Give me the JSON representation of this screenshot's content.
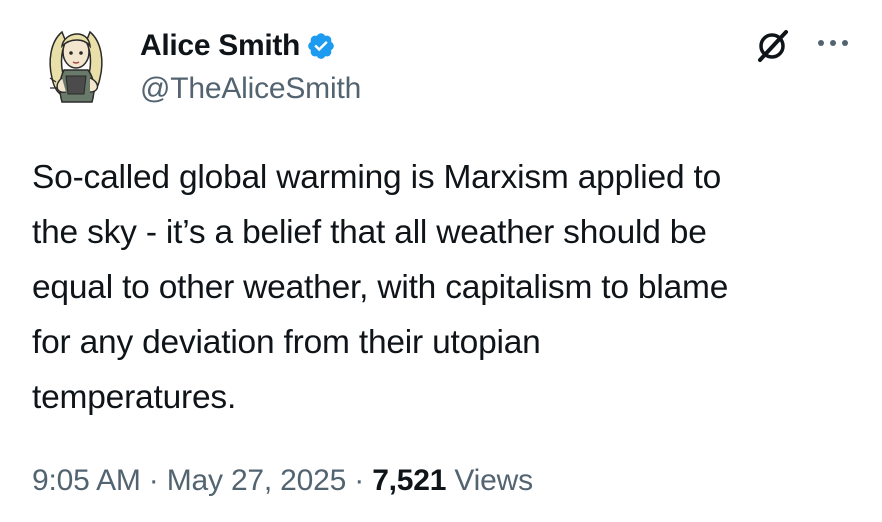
{
  "author": {
    "display_name": "Alice Smith",
    "handle": "@TheAliceSmith",
    "verified": true,
    "verified_color": "#1d9bf0",
    "avatar_icon": "cartoon-girl-avatar"
  },
  "actions": {
    "grok_icon": "grok-slash-icon",
    "more_icon": "ellipsis-icon"
  },
  "tweet": {
    "text": "So-called global warming is Marxism applied to\nthe sky - it’s a belief that all weather should be\nequal to other weather, with capitalism to blame\nfor any deviation from their utopian\ntemperatures."
  },
  "meta": {
    "time": "9:05 AM",
    "separator": " · ",
    "date": "May 27, 2025",
    "separator2": " · ",
    "views_count": "7,521",
    "views_label": " Views"
  },
  "colors": {
    "text_primary": "#0f1419",
    "text_secondary": "#536471",
    "accent": "#1d9bf0"
  }
}
